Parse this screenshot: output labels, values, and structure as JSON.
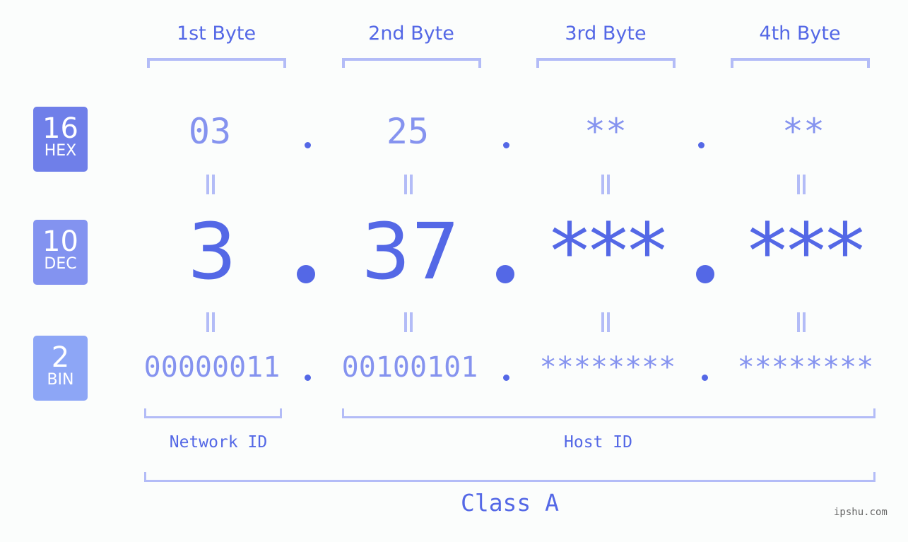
{
  "bytes": [
    {
      "label": "1st Byte",
      "hex": "03",
      "dec": "3",
      "bin": "00000011"
    },
    {
      "label": "2nd Byte",
      "hex": "25",
      "dec": "37",
      "bin": "00100101"
    },
    {
      "label": "3rd Byte",
      "hex": "**",
      "dec": "***",
      "bin": "********"
    },
    {
      "label": "4th Byte",
      "hex": "**",
      "dec": "***",
      "bin": "********"
    }
  ],
  "badges": {
    "hex": {
      "base": "16",
      "name": "HEX",
      "color": "#6f7fe9"
    },
    "dec": {
      "base": "10",
      "name": "DEC",
      "color": "#8393f0"
    },
    "bin": {
      "base": "2",
      "name": "BIN",
      "color": "#8da6f6"
    }
  },
  "segments": {
    "network": "Network ID",
    "host": "Host ID",
    "class": "Class A"
  },
  "watermark": "ipshu.com",
  "colors": {
    "accent": "#5468e6",
    "light_value": "#8593ef",
    "bracket": "#b3bcf7"
  }
}
